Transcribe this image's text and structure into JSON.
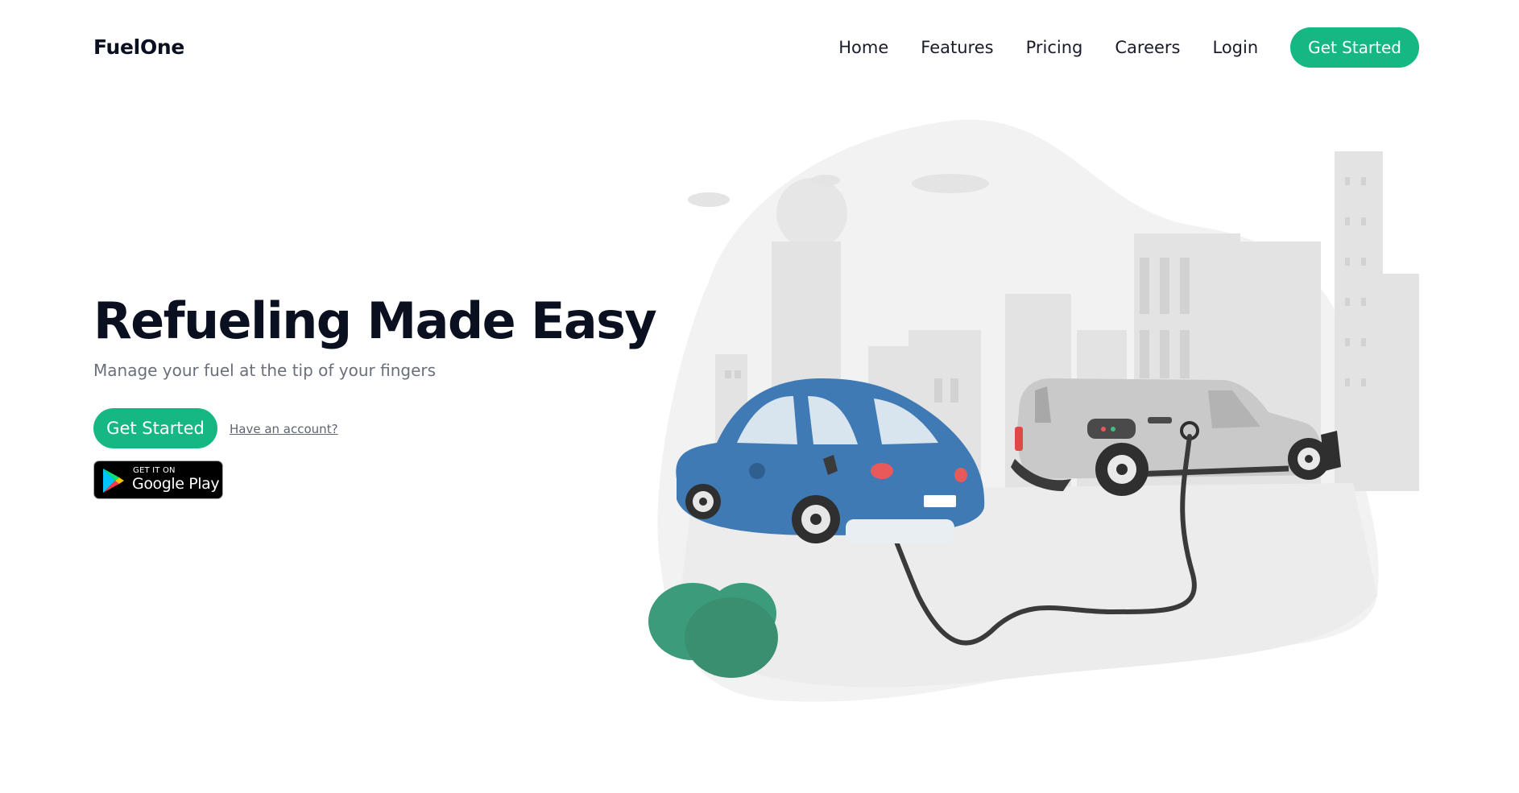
{
  "nav": {
    "brand": "FuelOne",
    "links": [
      "Home",
      "Features",
      "Pricing",
      "Careers",
      "Login"
    ],
    "cta": "Get Started"
  },
  "hero": {
    "title": "Refueling Made Easy",
    "subtitle": "Manage your fuel at the tip of your fingers",
    "cta": "Get Started",
    "account_link": "Have an account?"
  },
  "store_badge": {
    "small": "GET IT ON",
    "big": "Google Play",
    "icon": "google-play-icon"
  },
  "colors": {
    "accent": "#15b882",
    "title": "#0b1020",
    "subtitle": "#6a6f7a",
    "car": "#3f7ab5",
    "van": "#c9c9c9",
    "bush": "#3c9b7a"
  }
}
